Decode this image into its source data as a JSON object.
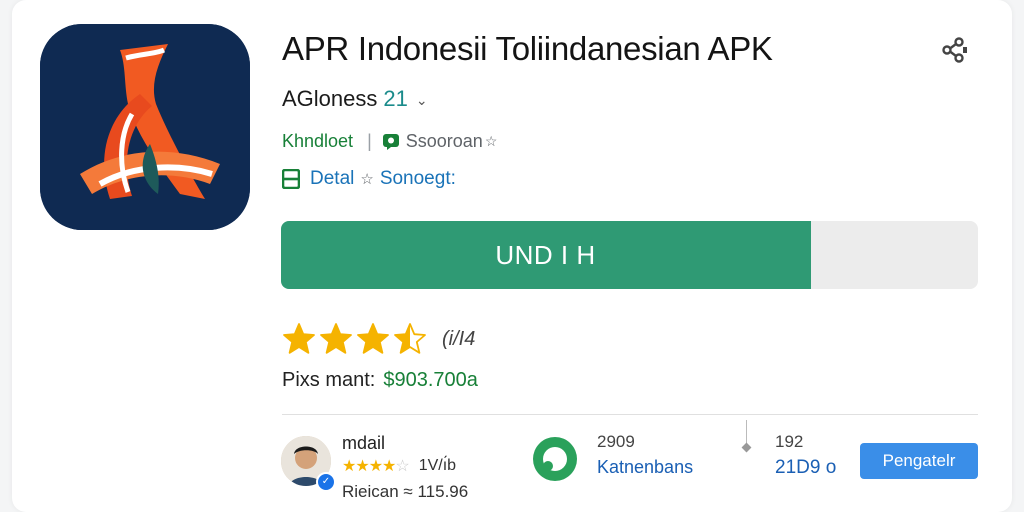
{
  "app": {
    "title": "APR Indonesii Toliindanesian APK",
    "developer": "AGloness",
    "version": "21",
    "category": "Khndloet",
    "downloads": "Ssooroan",
    "detail_label": "Detal",
    "detail_value": "Sonoegt:"
  },
  "icons": {
    "app": "app-logo-icon",
    "share": "share-icon",
    "chevron": "chevron-down-icon",
    "chat": "chat-icon",
    "box": "box-icon",
    "star": "star-icon",
    "ring": "ring-icon"
  },
  "progress": {
    "label": "UND I H",
    "fraction": 0.76,
    "fill_color": "#2f9a74"
  },
  "rating": {
    "stars": 3.5,
    "max": 5,
    "score": "(i/I4"
  },
  "price": {
    "label": "Pixs mant:",
    "value": "$903.700a"
  },
  "review": {
    "name": "mdail",
    "stars": 4.5,
    "count": "1V/ı́b",
    "sub": "Rieican ≈ 115.96"
  },
  "stats": {
    "a_top": "2909",
    "a_bottom": "Katnenbans",
    "b_top": "192",
    "b_bottom": "21D9 o"
  },
  "action_button": "Pengatelr",
  "colors": {
    "accent_green": "#2f9a74",
    "link_blue": "#1a73b8",
    "star_gold": "#f5b300",
    "button_blue": "#3a8ee8"
  }
}
